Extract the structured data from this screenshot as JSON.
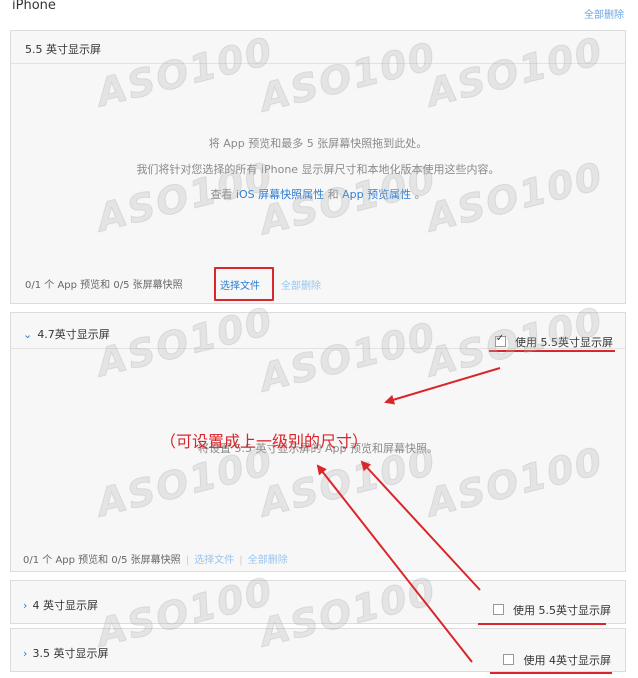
{
  "header": {
    "device": "iPhone",
    "delete_all": "全部删除"
  },
  "panel_55": {
    "title": "5.5 英寸显示屏",
    "drop_line1": "将 App 预览和最多 5 张屏幕快照拖到此处。",
    "drop_line2": "我们将针对您选择的所有 iPhone 显示屏尺寸和本地化版本使用这些内容。",
    "drop_line3_prefix": "查看",
    "drop_link1": "iOS 屏幕快照属性",
    "drop_line3_mid": "和",
    "drop_link2": "App 预览属性",
    "drop_line3_suffix": "。",
    "footer_count": "0/1 个 App 预览和 0/5 张屏幕快照",
    "choose_file": "选择文件",
    "delete_all": "全部删除"
  },
  "panel_47": {
    "title": "4.7英寸显示屏",
    "use_option": "使用 5.5英寸显示屏",
    "use_checked": true,
    "drop_text": "将设置 5.5 英寸显示屏的 App 预览和屏幕快照。",
    "footer_count": "0/1 个 App 预览和 0/5 张屏幕快照",
    "separator": "|",
    "choose_file": "选择文件",
    "delete_all": "全部删除"
  },
  "panel_40": {
    "title": "4 英寸显示屏",
    "use_option": "使用 5.5英寸显示屏",
    "use_checked": false
  },
  "panel_35": {
    "title": "3.5 英寸显示屏",
    "use_option": "使用 4英寸显示屏",
    "use_checked": false
  },
  "annotation": {
    "text": "（可设置成上一级别的尺寸）",
    "color": "#d9262b"
  },
  "watermark": "ASO100"
}
